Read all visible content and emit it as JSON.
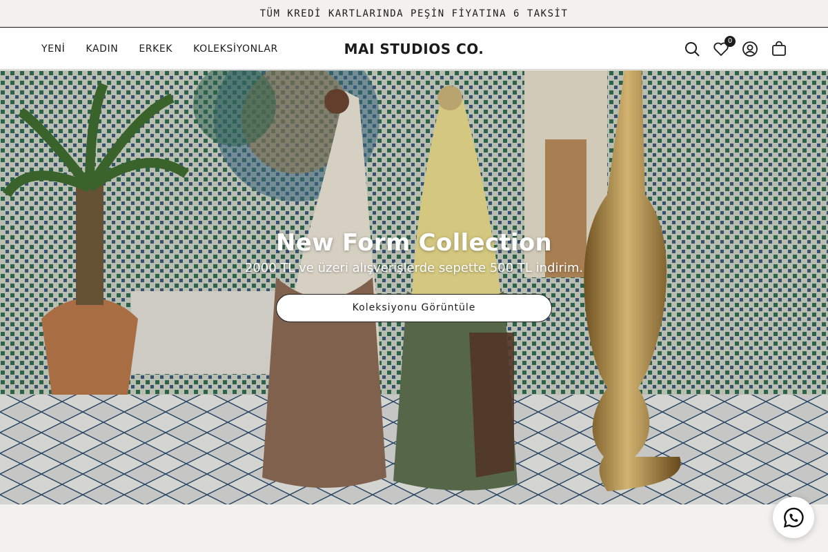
{
  "announcement": "TÜM KREDİ KARTLARINDA PEŞİN FİYATINA 6 TAKSİT",
  "header": {
    "nav": [
      "YENİ",
      "KADIN",
      "ERKEK",
      "KOLEKSİYONLAR"
    ],
    "logo": "MAI STUDIOS CO.",
    "icons": [
      "search-icon",
      "heart-icon",
      "account-icon",
      "bag-icon"
    ],
    "wishlist_count": "0"
  },
  "hero": {
    "title": "New Form Collection",
    "subtitle": "2000 TL ve üzeri alışverişlerde sepette 500 TL indirim.",
    "button_label": "Koleksiyonu Görüntüle"
  },
  "whatsapp": {
    "icon": "whatsapp-icon"
  }
}
